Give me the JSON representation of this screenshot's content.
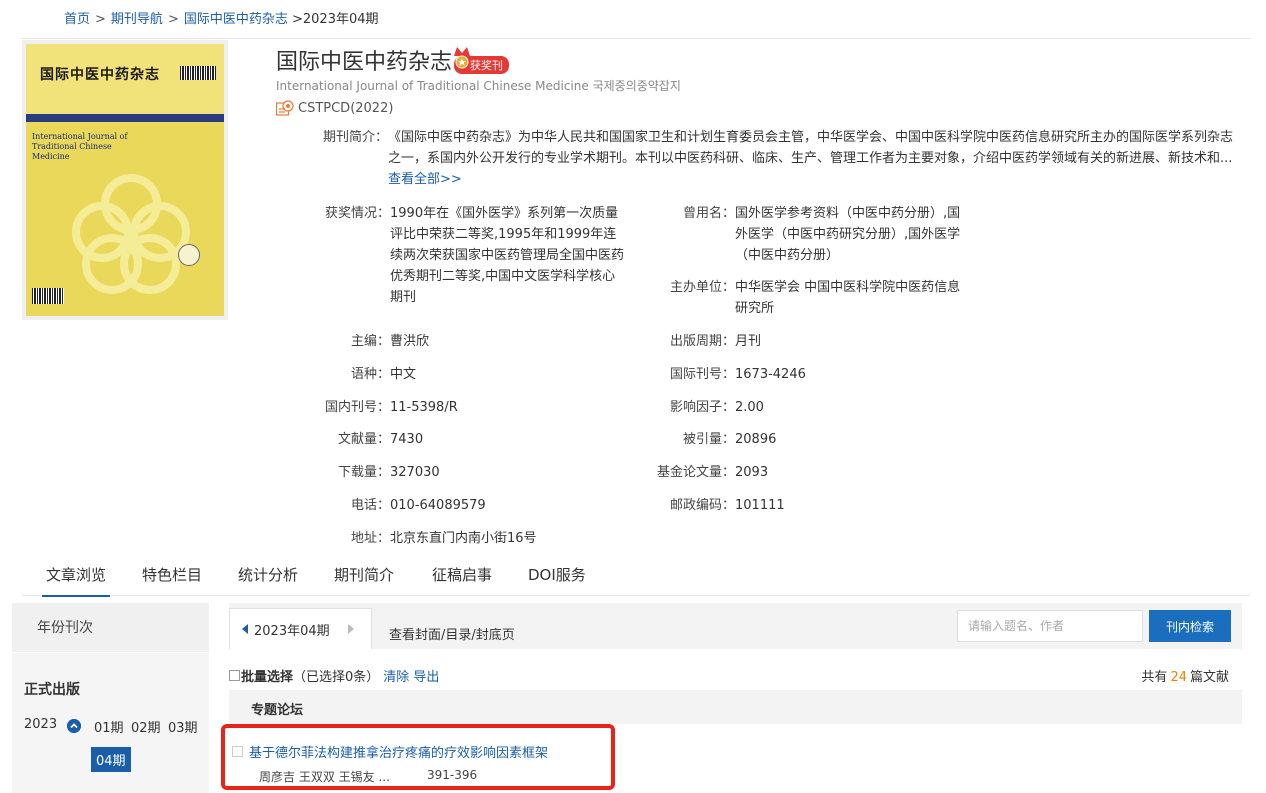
{
  "breadcrumb": {
    "home": "首页",
    "nav": "期刊导航",
    "journal": "国际中医中药杂志",
    "current": ">2023年04期",
    "sep": ">"
  },
  "cover": {
    "title_cn": "国际中医中药杂志",
    "title_en_l1": "International Journal of",
    "title_en_l2": "Traditional Chinese",
    "title_en_l3": "Medicine"
  },
  "journal": {
    "title": "国际中医中药杂志",
    "award_badge": "获奖刊",
    "english_name": "International Journal of Traditional Chinese Medicine 국제중의중약잡지",
    "index_tag": "CSTPCD(2022)",
    "intro_label": "期刊简介：",
    "intro_text": "《国际中医中药杂志》为中华人民共和国国家卫生和计划生育委员会主管，中华医学会、中国中医科学院中医药信息研究所主办的国际医学系列杂志之一，系国内外公开发行的专业学术期刊。本刊以中医药科研、临床、生产、管理工作者为主要对象，介绍中医药学领域有关的新进展、新技术和...",
    "view_all": "查看全部>>"
  },
  "info": {
    "awards_label": "获奖情况：",
    "awards_value": "1990年在《国外医学》系列第一次质量评比中荣获二等奖,1995年和1999年连续两次荣获国家中医药管理局全国中医药优秀期刊二等奖,中国中文医学科学核心期刊",
    "former_label": "曾用名：",
    "former_value": "国外医学参考资料（中医中药分册）,国外医学（中医中药研究分册）,国外医学（中医中药分册）",
    "sponsor_label": "主办单位：",
    "sponsor_value": "中华医学会 中国中医科学院中医药信息研究所",
    "editor_label": "主编：",
    "editor_value": "曹洪欣",
    "freq_label": "出版周期：",
    "freq_value": "月刊",
    "lang_label": "语种：",
    "lang_value": "中文",
    "issn_label": "国际刊号：",
    "issn_value": "1673-4246",
    "cn_label": "国内刊号：",
    "cn_value": "11-5398/R",
    "if_label": "影响因子：",
    "if_value": "2.00",
    "docs_label": "文献量：",
    "docs_value": "7430",
    "cited_label": "被引量：",
    "cited_value": "20896",
    "dl_label": "下载量：",
    "dl_value": "327030",
    "fund_label": "基金论文量：",
    "fund_value": "2093",
    "tel_label": "电话：",
    "tel_value": "010-64089579",
    "zip_label": "邮政编码：",
    "zip_value": "101111",
    "addr_label": "地址：",
    "addr_value": "北京东直门内南小街16号"
  },
  "tabs": [
    {
      "label": "文章浏览"
    },
    {
      "label": "特色栏目"
    },
    {
      "label": "统计分析"
    },
    {
      "label": "期刊简介"
    },
    {
      "label": "征稿启事"
    },
    {
      "label": "DOI服务"
    }
  ],
  "sidebar": {
    "year_head": "年份刊次",
    "published": "正式出版",
    "year": "2023",
    "issues": [
      "01期",
      "02期",
      "03期"
    ],
    "active_issue": "04期"
  },
  "panel": {
    "issue_label": "2023年04期",
    "cover_link": "查看封面/目录/封底页",
    "search_placeholder": "请输入题名、作者",
    "search_button": "刊内检索",
    "batch_label": "批量选择",
    "selected": "（已选择0条）",
    "clear": "清除",
    "export": "导出",
    "total_prefix": "共有",
    "total_count": "24",
    "total_suffix": "篇文献",
    "section": "专题论坛"
  },
  "articles": [
    {
      "title": "基于德尔菲法构建推拿治疗疼痛的疗效影响因素框架",
      "authors": "周彦吉 王双双 王锡友 ...",
      "pages": "391-396"
    }
  ],
  "colors": {
    "link": "#1a5ea8",
    "award": "#e53935",
    "highlight": "#e8241a",
    "count": "#f08000"
  }
}
